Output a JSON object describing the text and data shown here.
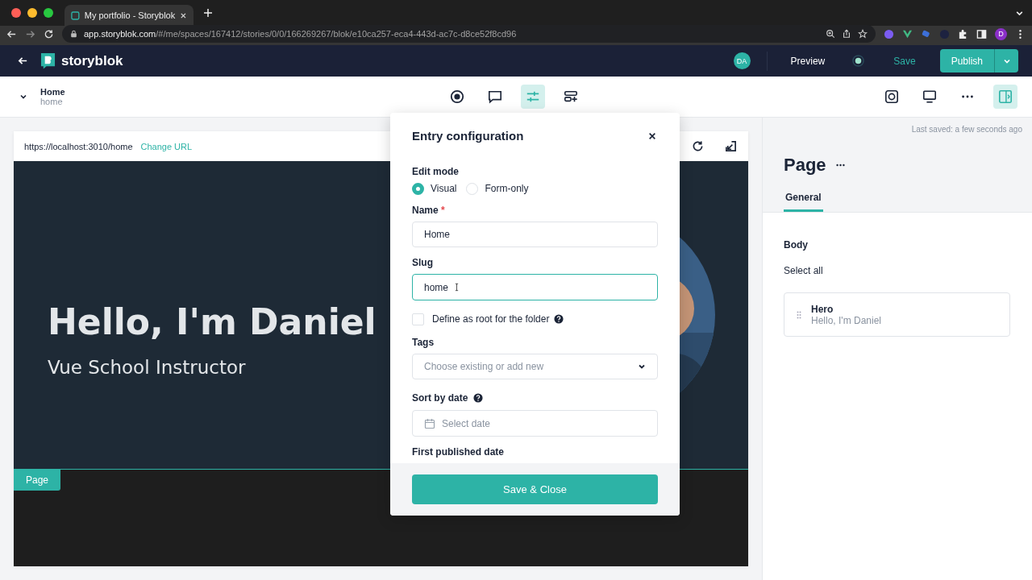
{
  "browser": {
    "tab_title": "My portfolio - Storyblok",
    "url_host": "app.storyblok.com",
    "url_path": "/#/me/spaces/167412/stories/0/0/166269267/blok/e10ca257-eca4-443d-ac7c-d8ce52f8cd96",
    "profile_initial": "D"
  },
  "app_header": {
    "logo_text": "storyblok",
    "avatar_initials": "DA",
    "preview": "Preview",
    "save": "Save",
    "publish": "Publish"
  },
  "story": {
    "name": "Home",
    "slug": "home"
  },
  "tools": [
    {
      "kind": "target",
      "selected": false
    },
    {
      "kind": "comments",
      "selected": false
    },
    {
      "kind": "settings",
      "selected": true
    },
    {
      "kind": "add-block",
      "selected": false
    }
  ],
  "view_tools": [
    {
      "kind": "screenshot",
      "selected": false
    },
    {
      "kind": "desktop",
      "selected": false
    },
    {
      "kind": "more",
      "selected": false
    },
    {
      "kind": "panel",
      "selected": true
    }
  ],
  "preview": {
    "url": "https://localhost:3010/home",
    "change_url": "Change URL",
    "hero_title": "Hello, I'm Daniel",
    "hero_subtitle": "Vue School Instructor",
    "page_badge": "Page"
  },
  "modal": {
    "title": "Entry configuration",
    "edit_mode_label": "Edit mode",
    "edit_modes": [
      {
        "label": "Visual",
        "selected": true
      },
      {
        "label": "Form-only",
        "selected": false
      }
    ],
    "name_label": "Name",
    "required_mark": "*",
    "name_value": "Home",
    "slug_label": "Slug",
    "slug_value": "home",
    "root_option": {
      "label": "Define as root for the folder",
      "checked": false
    },
    "tags_label": "Tags",
    "tags_placeholder": "Choose existing or add new",
    "sort_label": "Sort by date",
    "date_placeholder": "Select date",
    "first_published_label": "First published date",
    "save_button": "Save & Close"
  },
  "sidebar": {
    "last_saved": "Last saved: a few seconds ago",
    "title": "Page",
    "tabs": [
      {
        "label": "General",
        "selected": true
      }
    ],
    "body_label": "Body",
    "select_all": "Select all",
    "blocks": [
      {
        "title": "Hero",
        "subtitle": "Hello, I'm Daniel"
      }
    ]
  }
}
